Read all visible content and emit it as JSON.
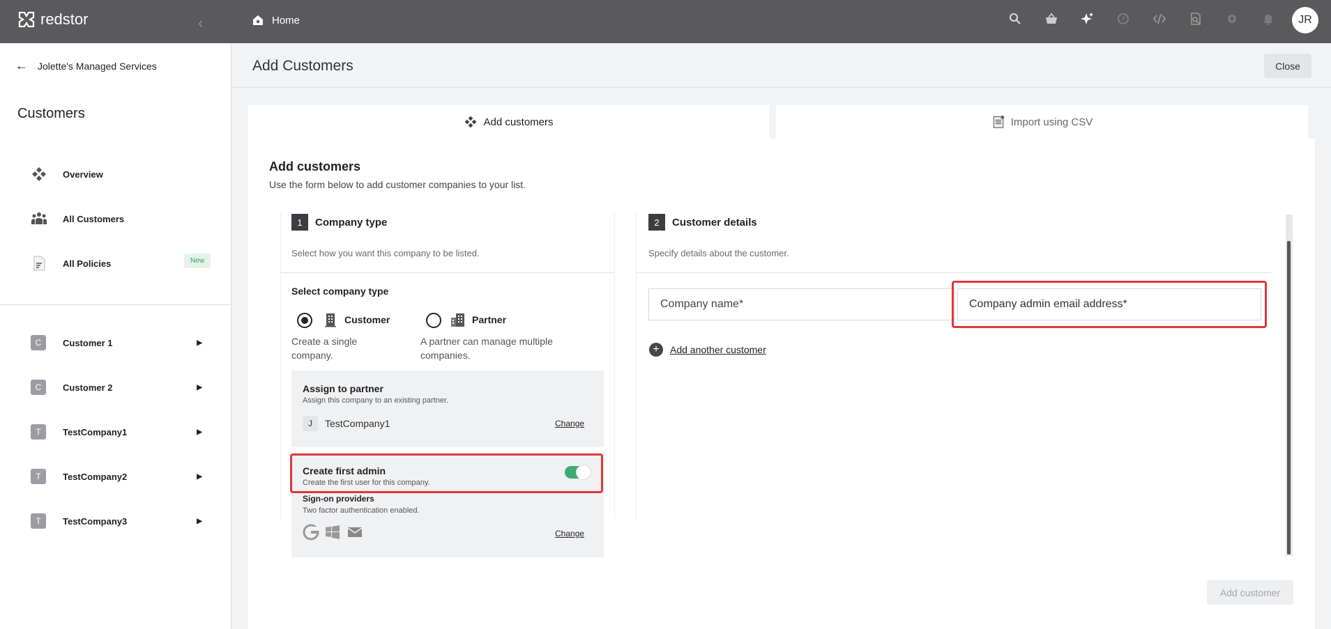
{
  "topbar": {
    "logo_text": "redstor",
    "home_label": "Home",
    "avatar_initials": "JR",
    "icons": [
      "search-icon",
      "basket-icon",
      "sparkle-icon",
      "help-icon",
      "code-icon",
      "inspect-icon",
      "gear-icon",
      "bell-icon"
    ]
  },
  "sidebar": {
    "back_label": "Jolette's Managed Services",
    "title": "Customers",
    "nav": [
      {
        "label": "Overview",
        "icon": "overview-icon"
      },
      {
        "label": "All Customers",
        "icon": "users-icon"
      },
      {
        "label": "All Policies",
        "icon": "document-icon",
        "badge": "New"
      }
    ],
    "customers": [
      {
        "letter": "C",
        "label": "Customer 1"
      },
      {
        "letter": "C",
        "label": "Customer 2"
      },
      {
        "letter": "T",
        "label": "TestCompany1"
      },
      {
        "letter": "T",
        "label": "TestCompany2"
      },
      {
        "letter": "T",
        "label": "TestCompany3"
      }
    ]
  },
  "main": {
    "page_title": "Add Customers",
    "close_label": "Close",
    "tabs": [
      {
        "label": "Add customers",
        "icon": "overview-icon"
      },
      {
        "label": "Import using CSV",
        "icon": "csv-icon"
      }
    ],
    "heading": "Add customers",
    "subheading": "Use the form below to add customer companies to your list.",
    "step1": {
      "num": "1",
      "title": "Company type",
      "desc": "Select how you want this company to be listed.",
      "select_label": "Select company type",
      "options": [
        {
          "label": "Customer",
          "desc": "Create a single company.",
          "selected": true
        },
        {
          "label": "Partner",
          "desc": "A partner can manage multiple companies.",
          "selected": false
        }
      ],
      "assign": {
        "title": "Assign to partner",
        "desc": "Assign this company to an existing partner.",
        "letter": "J",
        "partner": "TestCompany1",
        "change": "Change"
      },
      "admin": {
        "title": "Create first admin",
        "desc": "Create the first user for this company.",
        "enabled": true,
        "sso_title": "Sign-on providers",
        "sso_desc": "Two factor authentication enabled.",
        "change": "Change"
      }
    },
    "step2": {
      "num": "2",
      "title": "Customer details",
      "desc": "Specify details about the customer.",
      "company_name_placeholder": "Company name*",
      "admin_email_placeholder": "Company admin email address*",
      "add_another": "Add another customer"
    },
    "submit_label": "Add customer"
  }
}
